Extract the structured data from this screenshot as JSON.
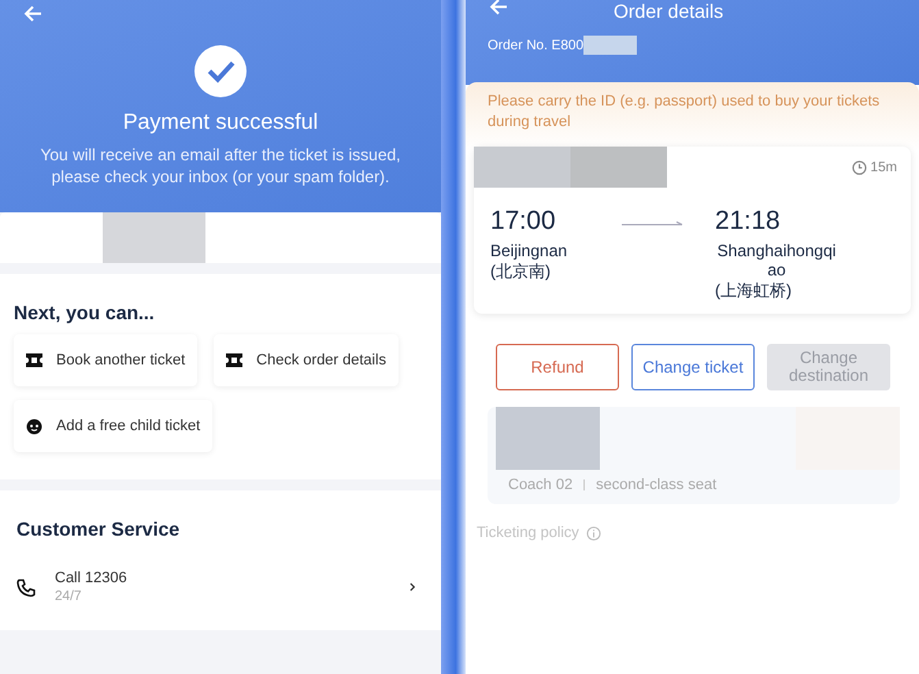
{
  "payment": {
    "title": "Payment successful",
    "message": "You will receive an email after the ticket is issued, please check your inbox (or your spam folder).",
    "next_title": "Next, you can...",
    "actions": [
      {
        "kind": "ticket",
        "label": "Book another ticket"
      },
      {
        "kind": "ticket",
        "label": "Check order details"
      },
      {
        "kind": "child",
        "label": "Add a free child ticket"
      }
    ],
    "customer_service": {
      "title": "Customer Service",
      "items": [
        {
          "label": "Call 12306",
          "sublabel": "24/7"
        }
      ]
    }
  },
  "order": {
    "title": "Order details",
    "order_no": "Order No. E800",
    "notice": "Please carry the ID (e.g. passport) used to buy your tickets during travel",
    "duration": "15m",
    "departure": {
      "time": "17:00",
      "station": "Beijingnan",
      "station_cn": "(北京南)"
    },
    "arrival": {
      "time": "21:18",
      "station": "Shanghaihongqiao",
      "station_cn": "(上海虹桥)"
    },
    "buttons": [
      {
        "kind": "refund",
        "label": "Refund",
        "disabled": false
      },
      {
        "kind": "change",
        "label": "Change ticket",
        "disabled": false
      },
      {
        "kind": "change",
        "label": "Change destination",
        "disabled": true
      }
    ],
    "seat": {
      "coach": "Coach 02",
      "seat_class": "second-class seat"
    },
    "policy": "Ticketing policy"
  }
}
